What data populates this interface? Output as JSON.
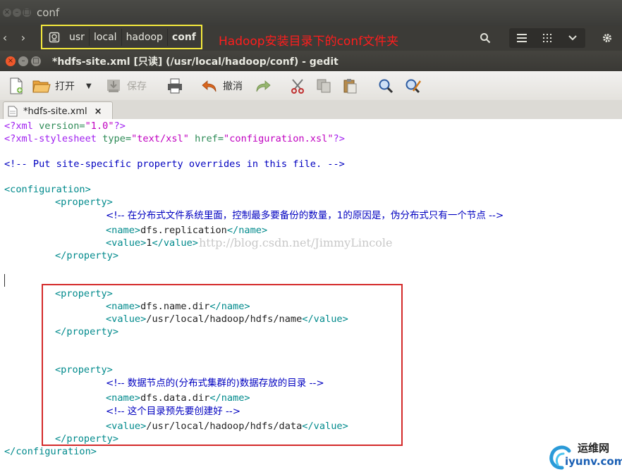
{
  "file_manager": {
    "title": "conf",
    "breadcrumb": [
      "usr",
      "local",
      "hadoop",
      "conf"
    ],
    "annotation": "Hadoop安装目录下的conf文件夹",
    "icons": [
      "back-icon",
      "forward-icon",
      "search-icon",
      "list-view-icon",
      "grid-view-icon",
      "chevron-down-icon",
      "gear-icon"
    ]
  },
  "gedit": {
    "title": "*hdfs-site.xml [只读] (/usr/local/hadoop/conf) - gedit",
    "toolbar": {
      "open_label": "打开",
      "save_label": "保存",
      "undo_label": "撤消"
    },
    "tab_label": "*hdfs-site.xml",
    "tab_close": "×"
  },
  "editor": {
    "line1": {
      "a": "<?xml ",
      "b": "version=",
      "c": "\"1.0\"",
      "d": "?>"
    },
    "line2": {
      "a": "<?xml-stylesheet ",
      "b": "type=",
      "c": "\"text/xsl\"",
      "d": " href=",
      "e": "\"configuration.xsl\"",
      "f": "?>"
    },
    "line3": "<!-- Put site-specific property overrides in this file. -->",
    "config_open": "<configuration>",
    "prop_open": "<property>",
    "prop_close": "</property>",
    "comment1": "<!-- 在分布式文件系统里面，控制最多要备份的数量，1的原因是，伪分布式只有一个节点 -->",
    "name_open": "<name>",
    "name_close": "</name>",
    "value_open": "<value>",
    "value_close": "</value>",
    "replication_name": "dfs.replication",
    "replication_value": "1",
    "name_dir_name": "dfs.name.dir",
    "name_dir_value": "/usr/local/hadoop/hdfs/name",
    "comment2": "<!-- 数据节点的(分布式集群的)数据存放的目录 -->",
    "data_dir_name": "dfs.data.dir",
    "comment3": "<!-- 这个目录预先要创建好 -->",
    "data_dir_value": "/usr/local/hadoop/hdfs/data",
    "config_close": "</configuration>"
  },
  "watermark": "http://blog.csdn.net/JimmyLincole",
  "logo": {
    "top": "运维网",
    "bottom": "iyunv.com"
  }
}
